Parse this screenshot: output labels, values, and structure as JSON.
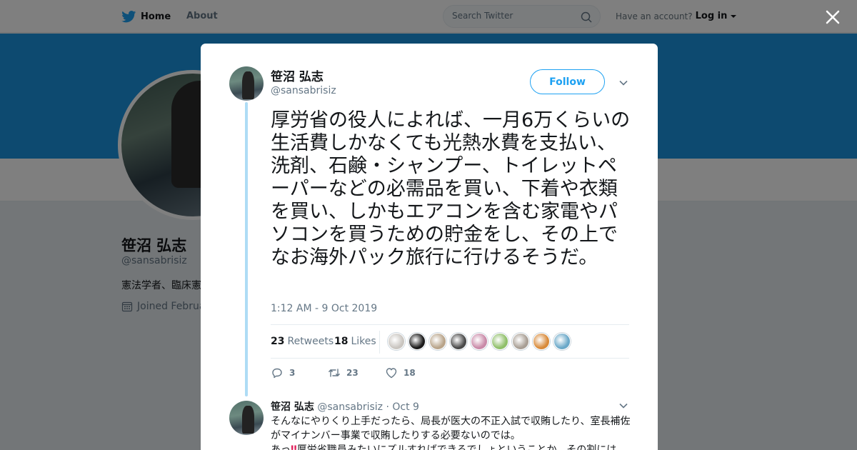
{
  "topbar": {
    "home_label": "Home",
    "about_label": "About",
    "search_placeholder": "Search Twitter",
    "have_account": "Have an account?",
    "login_label": "Log in"
  },
  "profile": {
    "name": "笹沼 弘志",
    "handle": "@sansabrisiz",
    "bio_visible": "憲法学者、臨床憲",
    "joined_visible": "Joined Februa"
  },
  "tweet": {
    "author_name": "笹沼 弘志",
    "author_handle": "@sansabrisiz",
    "follow_label": "Follow",
    "text": "厚労省の役人によれば、一月6万くらいの生活費しかなくても光熱水費を支払い、洗剤、石鹸・シャンプー、トイレットペーパーなどの必需品を買い、下着や衣類を買い、しかもエアコンを含む家電やパソコンを買うための貯金をし、その上でなお海外パック旅行に行けるそうだ。",
    "timestamp": "1:12 AM - 9 Oct 2019",
    "retweets_count": "23",
    "retweets_label": "Retweets",
    "likes_count": "18",
    "likes_label": "Likes",
    "liker_colors": [
      "#c9c5c0",
      "#1a1a1a",
      "#b8a48a",
      "#4a4a4a",
      "#c98aa8",
      "#8fbf6a",
      "#a89e94",
      "#d88a3a",
      "#6aa8c8"
    ],
    "reply_count": "3",
    "retweet_action_count": "23",
    "like_action_count": "18"
  },
  "reply": {
    "author_name": "笹沼 弘志",
    "author_handle": "@sansabrisiz",
    "separator": "·",
    "date": "Oct 9",
    "line1": "そんなにやりくり上手だったら、局長が医大の不正入試で収賄したり、室長補佐がマイナンバー事業で収賄したりする必要ないのでは。",
    "line2_prefix": "あっ",
    "line2_emoji": "‼",
    "line2_rest": "厚労省職員みたいにズルすればできるでしょということか。その割には"
  },
  "colors": {
    "brand": "#1da1f2",
    "banner": "#1b95e0",
    "thread_line": "#aedcf5"
  }
}
